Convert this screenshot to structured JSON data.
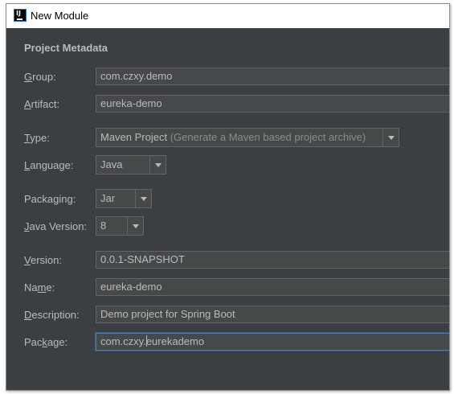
{
  "window": {
    "title": "New Module",
    "icon": "intellij-idea-icon"
  },
  "section_title": "Project Metadata",
  "fields": {
    "group": {
      "label_ul": "G",
      "label_rest": "roup:",
      "value": "com.czxy.demo"
    },
    "artifact": {
      "label_ul": "A",
      "label_rest": "rtifact:",
      "value": "eureka-demo"
    },
    "version": {
      "label_ul": "V",
      "label_rest": "ersion:",
      "value": "0.0.1-SNAPSHOT"
    },
    "name": {
      "label_pre": "Na",
      "label_ul": "m",
      "label_rest": "e:",
      "value": "eureka-demo"
    },
    "description": {
      "label_ul": "D",
      "label_rest": "escription:",
      "value": "Demo project for Spring Boot"
    },
    "package": {
      "label_pre": "Pac",
      "label_ul": "k",
      "label_rest": "age:",
      "value_before_caret": "com.czxy.",
      "value_after_caret": "eurekademo"
    }
  },
  "selects": {
    "type": {
      "label_ul": "T",
      "label_rest": "ype:",
      "value": "Maven Project",
      "hint": "(Generate a Maven based project archive)"
    },
    "language": {
      "label_ul": "L",
      "label_rest": "anguage:",
      "value": "Java"
    },
    "packaging": {
      "label_pre": "Packa",
      "label_ul": "g",
      "label_rest": "ing:",
      "value": "Jar"
    },
    "java_version": {
      "label_ul": "J",
      "label_rest": "ava Version:",
      "value": "8"
    }
  },
  "colors": {
    "background": "#3c3f41",
    "field_bg": "#45494a",
    "text": "#bbbbbb",
    "focus": "#4d7bb5"
  }
}
